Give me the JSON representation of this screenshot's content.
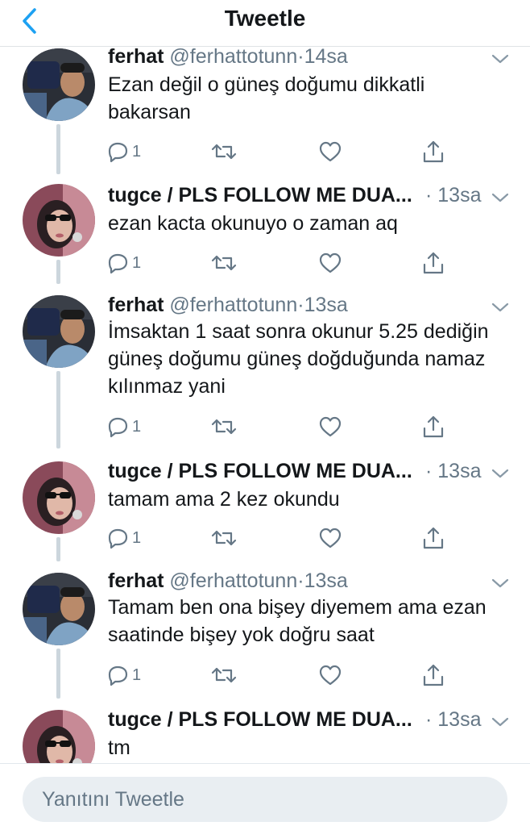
{
  "header": {
    "title": "Tweetle",
    "back_icon": "chevron-left-icon"
  },
  "colors": {
    "accent": "#1da1f2",
    "muted": "#657786",
    "text": "#14171a",
    "thread_line": "#ccd6dd"
  },
  "tweets": [
    {
      "name": "ferhat",
      "handle": "@ferhattotunn",
      "dot": "·",
      "time": "14sa",
      "text": "Ezan değil o güneş doğumu dikkatli bakarsan",
      "replies": "1",
      "avatar": "ferhat"
    },
    {
      "name": "tugce / PLS FOLLOW ME DUA...",
      "handle": "",
      "dot": "·",
      "time": "13sa",
      "text": "ezan kacta okunuyo o zaman aq",
      "replies": "1",
      "avatar": "tugce"
    },
    {
      "name": "ferhat",
      "handle": "@ferhattotunn",
      "dot": "·",
      "time": "13sa",
      "text": "İmsaktan 1 saat sonra okunur 5.25 dediğin güneş doğumu güneş doğduğunda namaz kılınmaz yani",
      "replies": "1",
      "avatar": "ferhat"
    },
    {
      "name": "tugce / PLS FOLLOW ME DUA...",
      "handle": "",
      "dot": "·",
      "time": "13sa",
      "text": "tamam ama 2 kez okundu",
      "replies": "1",
      "avatar": "tugce"
    },
    {
      "name": "ferhat",
      "handle": "@ferhattotunn",
      "dot": "·",
      "time": "13sa",
      "text": "Tamam ben ona bişey diyemem ama ezan saatinde bişey yok doğru saat",
      "replies": "1",
      "avatar": "ferhat"
    },
    {
      "name": "tugce / PLS FOLLOW ME DUA...",
      "handle": "",
      "dot": "·",
      "time": "13sa",
      "text": "tm",
      "replies": "",
      "avatar": "tugce"
    }
  ],
  "reply": {
    "placeholder": "Yanıtını Tweetle"
  }
}
